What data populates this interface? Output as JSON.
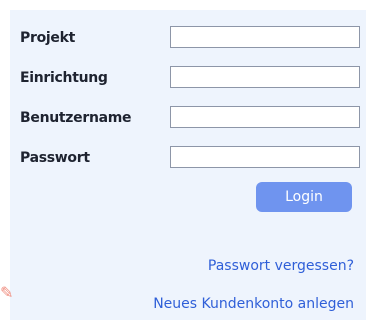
{
  "form": {
    "fields": [
      {
        "label": "Projekt",
        "value": ""
      },
      {
        "label": "Einrichtung",
        "value": ""
      },
      {
        "label": "Benutzername",
        "value": ""
      },
      {
        "label": "Passwort",
        "value": ""
      }
    ],
    "login_label": "Login"
  },
  "links": {
    "forgot_password": "Passwort vergessen?",
    "new_account": "Neues Kundenkonto anlegen"
  },
  "colors": {
    "panel_bg": "#eef4fd",
    "button_bg": "#6f94ef",
    "link": "#2f5fd8"
  }
}
